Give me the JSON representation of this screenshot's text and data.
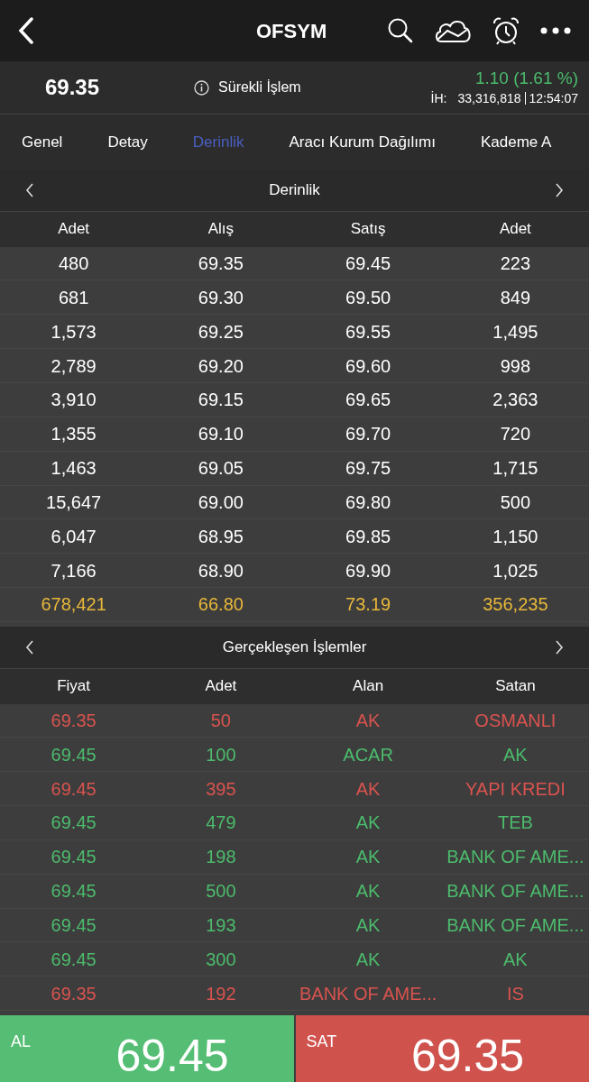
{
  "header": {
    "title": "OFSYM"
  },
  "quote": {
    "price": "69.35",
    "status": "Sürekli İşlem",
    "change": "1.10 (1.61 %)",
    "volume_label": "İH:",
    "volume": "33,316,818",
    "time": "12:54:07"
  },
  "tabs": [
    {
      "label": "Genel",
      "selected": false
    },
    {
      "label": "Detay",
      "selected": false
    },
    {
      "label": "Derinlik",
      "selected": true
    },
    {
      "label": "Aracı Kurum Dağılımı",
      "selected": false
    },
    {
      "label": "Kademe A",
      "selected": false
    }
  ],
  "depth": {
    "title": "Derinlik",
    "columns": [
      "Adet",
      "Alış",
      "Satış",
      "Adet"
    ],
    "rows": [
      {
        "kind": "level",
        "cells": [
          "480",
          "69.35",
          "69.45",
          "223"
        ]
      },
      {
        "kind": "level",
        "cells": [
          "681",
          "69.30",
          "69.50",
          "849"
        ]
      },
      {
        "kind": "level",
        "cells": [
          "1,573",
          "69.25",
          "69.55",
          "1,495"
        ]
      },
      {
        "kind": "level",
        "cells": [
          "2,789",
          "69.20",
          "69.60",
          "998"
        ]
      },
      {
        "kind": "level",
        "cells": [
          "3,910",
          "69.15",
          "69.65",
          "2,363"
        ]
      },
      {
        "kind": "level",
        "cells": [
          "1,355",
          "69.10",
          "69.70",
          "720"
        ]
      },
      {
        "kind": "level",
        "cells": [
          "1,463",
          "69.05",
          "69.75",
          "1,715"
        ]
      },
      {
        "kind": "level",
        "cells": [
          "15,647",
          "69.00",
          "69.80",
          "500"
        ]
      },
      {
        "kind": "level",
        "cells": [
          "6,047",
          "68.95",
          "69.85",
          "1,150"
        ]
      },
      {
        "kind": "level",
        "cells": [
          "7,166",
          "68.90",
          "69.90",
          "1,025"
        ]
      },
      {
        "kind": "total",
        "cells": [
          "678,421",
          "66.80",
          "73.19",
          "356,235"
        ]
      }
    ]
  },
  "trades": {
    "title": "Gerçekleşen İşlemler",
    "columns": [
      "Fiyat",
      "Adet",
      "Alan",
      "Satan"
    ],
    "rows": [
      {
        "kind": "sell",
        "cells": [
          "69.35",
          "50",
          "AK",
          "OSMANLI"
        ]
      },
      {
        "kind": "buy",
        "cells": [
          "69.45",
          "100",
          "ACAR",
          "AK"
        ]
      },
      {
        "kind": "sell",
        "cells": [
          "69.45",
          "395",
          "AK",
          "YAPI KREDI"
        ]
      },
      {
        "kind": "buy",
        "cells": [
          "69.45",
          "479",
          "AK",
          "TEB"
        ]
      },
      {
        "kind": "buy",
        "cells": [
          "69.45",
          "198",
          "AK",
          "BANK OF AME..."
        ]
      },
      {
        "kind": "buy",
        "cells": [
          "69.45",
          "500",
          "AK",
          "BANK OF AME..."
        ]
      },
      {
        "kind": "buy",
        "cells": [
          "69.45",
          "193",
          "AK",
          "BANK OF AME..."
        ]
      },
      {
        "kind": "buy",
        "cells": [
          "69.45",
          "300",
          "AK",
          "AK"
        ]
      },
      {
        "kind": "sell",
        "cells": [
          "69.35",
          "192",
          "BANK OF AME...",
          "IS"
        ]
      }
    ]
  },
  "actions": [
    {
      "kind": "buy",
      "label": "AL",
      "price": "69.45"
    },
    {
      "kind": "sell",
      "label": "SAT",
      "price": "69.35"
    }
  ]
}
